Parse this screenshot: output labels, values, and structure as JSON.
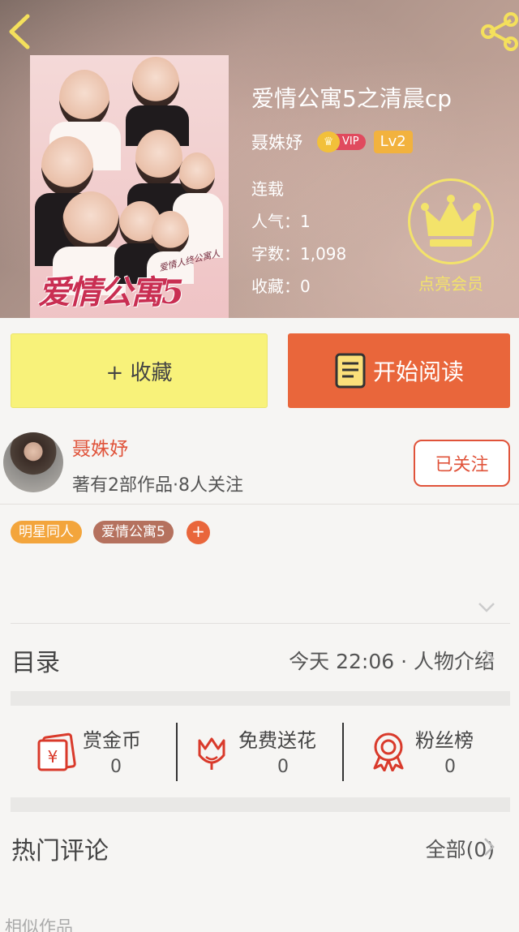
{
  "book": {
    "title": "爱情公寓5之清晨cp",
    "author": "聂姝妤",
    "vip_label": "VIP",
    "level": "Lv2",
    "status": "连载",
    "popularity": "人气：1",
    "word_count": "字数：1,098",
    "favorites": "收藏：0",
    "cover_title": "爱情公寓5",
    "cover_signature": "爱情人终公寓人"
  },
  "member": {
    "label": "点亮会员"
  },
  "actions": {
    "collect": "+ 收藏",
    "read": "开始阅读"
  },
  "author_card": {
    "name": "聂姝妤",
    "meta": "著有2部作品·8人关注",
    "follow": "已关注"
  },
  "tags": [
    {
      "label": "明星同人",
      "color": "#f3a53c"
    },
    {
      "label": "爱情公寓5",
      "color": "#b5715e"
    }
  ],
  "tag_add": "+",
  "toc": {
    "label": "目录",
    "latest": "今天 22:06 · 人物介绍"
  },
  "rewards": [
    {
      "title": "赏金币",
      "count": "0",
      "icon": "red-envelope-icon"
    },
    {
      "title": "免费送花",
      "count": "0",
      "icon": "flower-icon"
    },
    {
      "title": "粉丝榜",
      "count": "0",
      "icon": "rosette-icon"
    }
  ],
  "comments": {
    "label": "热门评论",
    "all": "全部(0)"
  },
  "similar": {
    "label": "相似作品"
  },
  "colors": {
    "accent_orange": "#e9663b",
    "accent_yellow": "#f8f27a",
    "author_red": "#e0533a",
    "member_gold": "#f3e36a"
  }
}
